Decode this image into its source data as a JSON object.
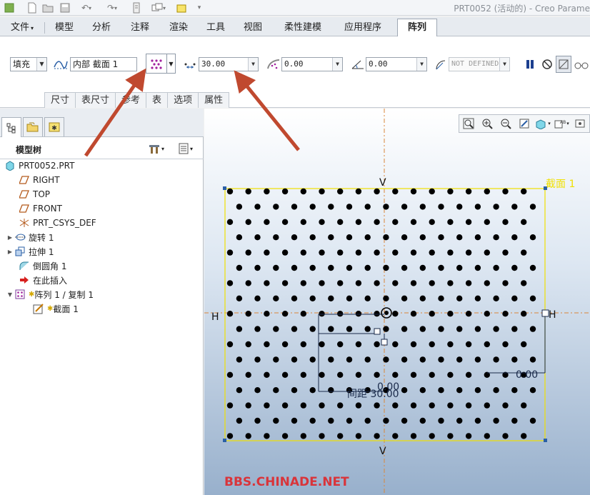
{
  "window": {
    "title": "PRT0052 (活动的) - Creo Parame"
  },
  "menubar": {
    "items": [
      {
        "label": "文件",
        "active": false
      },
      {
        "label": "模型",
        "active": false
      },
      {
        "label": "分析",
        "active": false
      },
      {
        "label": "注释",
        "active": false
      },
      {
        "label": "渲染",
        "active": false
      },
      {
        "label": "工具",
        "active": false
      },
      {
        "label": "视图",
        "active": false
      },
      {
        "label": "柔性建模",
        "active": false
      },
      {
        "label": "应用程序",
        "active": false
      },
      {
        "label": "阵列",
        "active": true
      }
    ]
  },
  "ribbon": {
    "pattern_type": "填充",
    "sketch_ref": "内部 截面 1",
    "spacing_value": "30.00",
    "border_value": "0.00",
    "rotation_value": "0.00",
    "radius_value": "NOT DEFINED",
    "subtabs": [
      "尺寸",
      "表尺寸",
      "参考",
      "表",
      "选项",
      "属性"
    ]
  },
  "model_tree": {
    "header": "模型树",
    "items": [
      {
        "label": "PRT0052.PRT",
        "icon": "part-icon",
        "expand": "",
        "indent": 0
      },
      {
        "label": "RIGHT",
        "icon": "datum-plane-icon",
        "expand": "",
        "indent": 1
      },
      {
        "label": "TOP",
        "icon": "datum-plane-icon",
        "expand": "",
        "indent": 1
      },
      {
        "label": "FRONT",
        "icon": "datum-plane-icon",
        "expand": "",
        "indent": 1
      },
      {
        "label": "PRT_CSYS_DEF",
        "icon": "csys-icon",
        "expand": "",
        "indent": 1
      },
      {
        "label": "旋转 1",
        "icon": "revolve-icon",
        "expand": "▶",
        "indent": 1
      },
      {
        "label": "拉伸 1",
        "icon": "extrude-icon",
        "expand": "▶",
        "indent": 1
      },
      {
        "label": "倒圆角 1",
        "icon": "round-icon",
        "expand": "",
        "indent": 1
      },
      {
        "label": "在此插入",
        "icon": "insert-arrow-icon",
        "expand": "",
        "indent": 1
      },
      {
        "label": "阵列 1 / 复制 1",
        "icon": "pattern-icon",
        "expand": "▼",
        "indent": 1,
        "star": "✱"
      },
      {
        "label": "截面 1",
        "icon": "sketch-icon",
        "expand": "",
        "indent": 2,
        "star": "✱"
      }
    ]
  },
  "viewport": {
    "section_label": "截面 1",
    "datum_v": "V",
    "datum_h": "H",
    "dim_spacing": "间距 30.00",
    "dim_a": "0.00",
    "dim_b": "0.00",
    "watermark": "BBS.CHINADE.NET",
    "colors": {
      "section_border": "#f0e000",
      "dots": "#000000",
      "arrows": "#c0492f",
      "watermark": "#d9343a"
    }
  }
}
